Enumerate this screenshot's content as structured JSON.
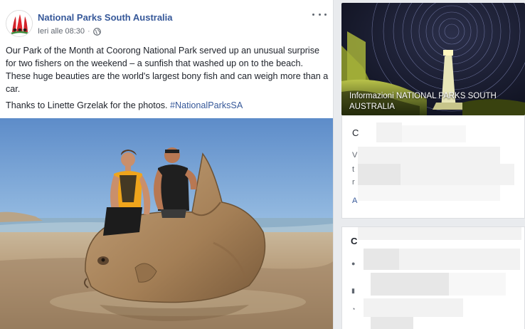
{
  "post": {
    "page_name": "National Parks South Australia",
    "timestamp": "Ieri alle 08:30",
    "paragraph_1": "Our Park of the Month at Coorong National Park served up an unusual surprise for two fishers on the weekend – a sunfish that washed up on to the beach. These huge beauties are the world's largest bony fish and can weigh more than a car.",
    "paragraph_2_prefix": "Thanks to Linette Grzelak for the photos.",
    "hashtag": "#NationalParksSA",
    "privacy_icon": "globe-icon",
    "more_icon": "ellipsis-icon"
  },
  "sidebar": {
    "cover_caption": "Informazioni NATIONAL PARKS SOUTH AUSTRALIA",
    "info_stub_letter_1": "C",
    "info_stub_letter_2": "V",
    "info_stub_letter_3": "t",
    "info_stub_letter_4": "r",
    "info_stub_link": "A",
    "community_stub_heading": "C"
  },
  "colors": {
    "link": "#365899",
    "text": "#1d2129",
    "meta": "#616770",
    "page_bg": "#e9ebee"
  }
}
